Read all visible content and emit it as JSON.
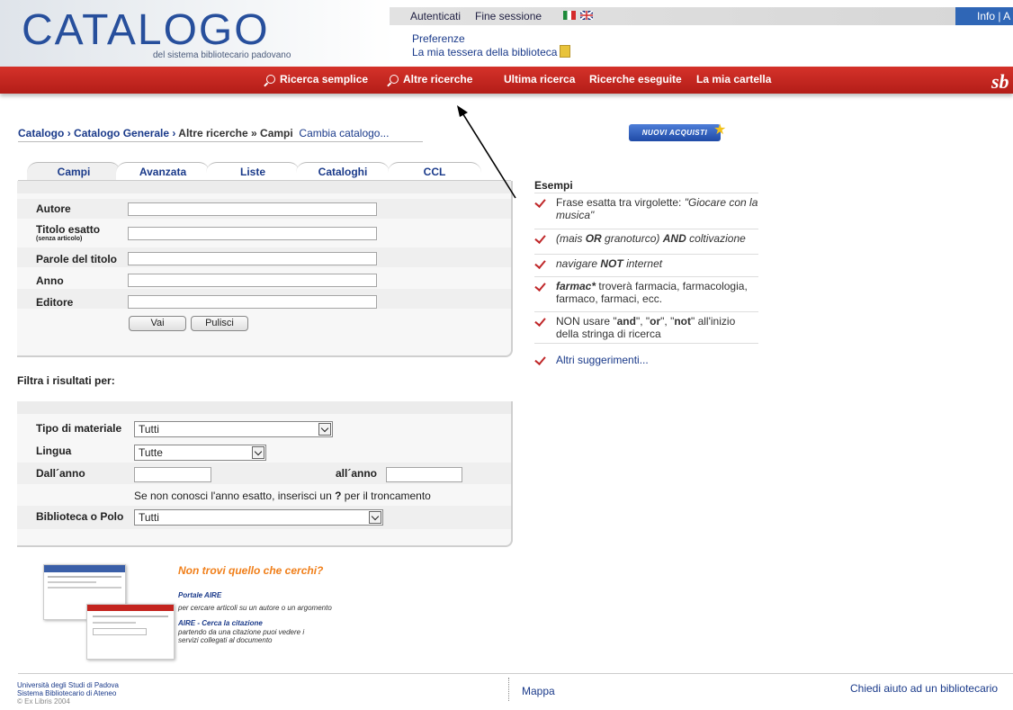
{
  "header": {
    "logo_title": "CATALOGO",
    "logo_subtitle": "del sistema bibliotecario padovano",
    "top_links": {
      "authenticated": "Autenticati",
      "logout": "Fine sessione",
      "info": "Info | A"
    },
    "preferences": "Preferenze",
    "library_card": "La mia tessera della biblioteca",
    "brand_mark": "sb"
  },
  "nav": {
    "simple_search": "Ricerca semplice",
    "other_searches": "Altre ricerche",
    "last_search": "Ultima ricerca",
    "executed_searches": "Ricerche eseguite",
    "my_folder": "La mia cartella"
  },
  "breadcrumb": {
    "catalog": "Catalogo",
    "general": "Catalogo Generale",
    "other": "Altre ricerche",
    "fields": "Campi",
    "change_catalog": "Cambia catalogo...",
    "sep1": "›",
    "sep2": "»"
  },
  "tabs": [
    "Campi",
    "Avanzata",
    "Liste",
    "Cataloghi",
    "CCL"
  ],
  "search_form": {
    "author_label": "Autore",
    "exact_title_label": "Titolo esatto",
    "exact_title_hint": "(senza articolo)",
    "title_words_label": "Parole del titolo",
    "year_label": "Anno",
    "publisher_label": "Editore",
    "go_button": "Vai",
    "clear_button": "Pulisci"
  },
  "filters": {
    "heading": "Filtra i risultati per:",
    "material_label": "Tipo di materiale",
    "material_value": "Tutti",
    "language_label": "Lingua",
    "language_value": "Tutte",
    "from_year_label": "Dall´anno",
    "to_year_label": "all´anno",
    "hint_pre": "Se non conosci l'anno esatto, inserisci un",
    "hint_char": "?",
    "hint_post": "per il troncamento",
    "library_label": "Biblioteca o Polo",
    "library_value": "Tutti"
  },
  "new_acquisitions": "NUOVI ACQUISTI",
  "examples": {
    "title": "Esempi",
    "ex1_pre": "Frase esatta tra virgolette:",
    "ex1_quote": "\"Giocare con la musica\"",
    "ex2_a": "(mais",
    "ex2_or": "OR",
    "ex2_b": "granoturco)",
    "ex2_and": "AND",
    "ex2_c": "coltivazione",
    "ex3_a": "navigare",
    "ex3_not": "NOT",
    "ex3_b": "internet",
    "ex4_term": "farmac*",
    "ex4_rest": "troverà farmacia, farmacologia, farmaco, farmaci, ecc.",
    "ex5_a": "NON usare \"",
    "ex5_and": "and",
    "ex5_b": "\", \"",
    "ex5_or": "or",
    "ex5_c": "\", \"",
    "ex5_not": "not",
    "ex5_d": "\" all'inizio della stringa di ricerca",
    "more": "Altri suggerimenti..."
  },
  "promo": {
    "title": "Non trovi quello che cerchi?",
    "link1": "Portale AIRE",
    "desc1": "per cercare articoli su un autore o un argomento",
    "link2": "AIRE - Cerca la citazione",
    "desc2": "partendo da una citazione puoi vedere i servizi collegati al documento"
  },
  "footer": {
    "university": "Università degli Studi di Padova",
    "system": "Sistema Bibliotecario di Ateneo",
    "copyright": "© Ex Libris 2004",
    "map": "Mappa",
    "ask_librarian": "Chiedi aiuto ad un bibliotecario"
  },
  "colors": {
    "nav_red": "#c4241f",
    "link_blue": "#1a3a8a",
    "promo_orange": "#f07f1a",
    "check_red": "#c0282a"
  }
}
